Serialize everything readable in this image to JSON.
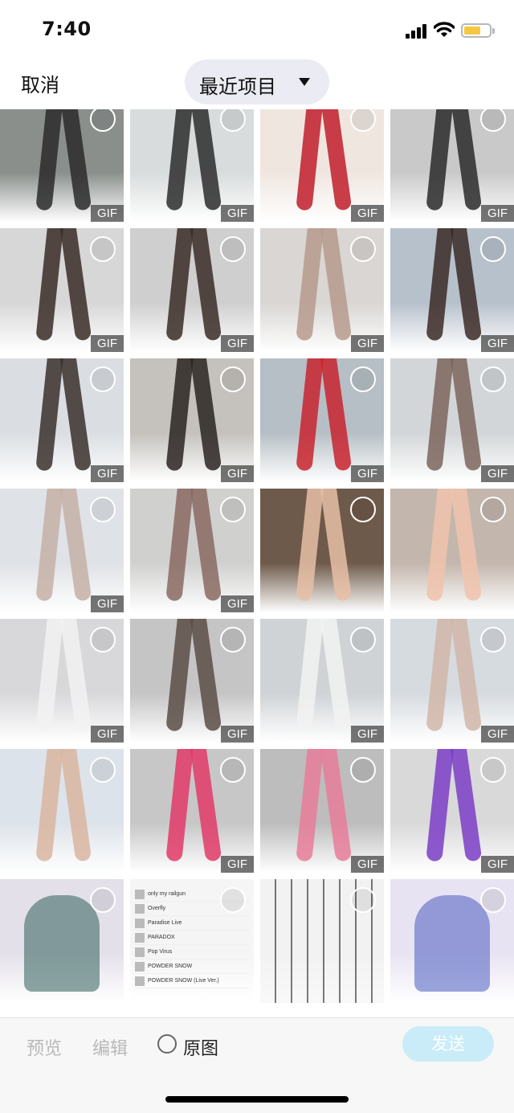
{
  "status_bar": {
    "time": "7:40",
    "battery_color": "#f5c842"
  },
  "header": {
    "cancel_label": "取消",
    "album_label": "最近项目",
    "dropdown_icon": "caret-down-icon"
  },
  "grid": {
    "gif_badge": "GIF",
    "tiles": [
      {
        "gif": true,
        "bg": "#8a8f8c",
        "accent": "#2a2a2a"
      },
      {
        "gif": true,
        "bg": "#d8dcdc",
        "accent": "#2b2b2b"
      },
      {
        "gif": true,
        "bg": "#efe6e0",
        "accent": "#c01d2a"
      },
      {
        "gif": true,
        "bg": "#c9c9c9",
        "accent": "#2a2a2a"
      },
      {
        "gif": true,
        "bg": "#d7d7d7",
        "accent": "#3a2c28"
      },
      {
        "gif": true,
        "bg": "#cfcfcf",
        "accent": "#3a2c28"
      },
      {
        "gif": true,
        "bg": "#d9d6d3",
        "accent": "#b69a8c"
      },
      {
        "gif": true,
        "bg": "#b7c1cc",
        "accent": "#3b2a26"
      },
      {
        "gif": true,
        "bg": "#dadee2",
        "accent": "#3a302c"
      },
      {
        "gif": true,
        "bg": "#c5c2bd",
        "accent": "#2a2422"
      },
      {
        "gif": true,
        "bg": "#b6bfc5",
        "accent": "#c8232e"
      },
      {
        "gif": true,
        "bg": "#d3d6d8",
        "accent": "#7b655d"
      },
      {
        "gif": true,
        "bg": "#dfe2e6",
        "accent": "#c5b0a6"
      },
      {
        "gif": true,
        "bg": "#d0d0cf",
        "accent": "#8a6a62"
      },
      {
        "gif": false,
        "bg": "#6e5a4a",
        "accent": "#e7c0a6"
      },
      {
        "gif": false,
        "bg": "#c3b6ad",
        "accent": "#f0c3ad"
      },
      {
        "gif": true,
        "bg": "#d8d8db",
        "accent": "#f2f2f2"
      },
      {
        "gif": true,
        "bg": "#c5c5c5",
        "accent": "#5a4c47"
      },
      {
        "gif": true,
        "bg": "#cfd3d6",
        "accent": "#f2f2f2"
      },
      {
        "gif": true,
        "bg": "#d6dbe0",
        "accent": "#d1b6a8"
      },
      {
        "gif": false,
        "bg": "#dde3ea",
        "accent": "#d9b5a0"
      },
      {
        "gif": true,
        "bg": "#c7c7c7",
        "accent": "#e03a68"
      },
      {
        "gif": true,
        "bg": "#bdbdbd",
        "accent": "#e77c9a"
      },
      {
        "gif": true,
        "bg": "#d9d9d9",
        "accent": "#7a3dc6"
      },
      {
        "gif": false,
        "bg": "#e4e0ea",
        "accent": "#2f5f5a"
      },
      {
        "gif": false,
        "bg": "#f5f5f5",
        "accent": "#888888"
      },
      {
        "gif": false,
        "bg": "#efefef",
        "accent": "#222222"
      },
      {
        "gif": false,
        "bg": "#e8e3f2",
        "accent": "#4a5cc0"
      }
    ],
    "music_list": [
      "only my railgun",
      "Overfly",
      "Paradise Live",
      "PARADOX",
      "Pop Virus",
      "POWDER SNOW",
      "POWDER SNOW (Live Ver.)"
    ]
  },
  "bottom_bar": {
    "preview_label": "预览",
    "edit_label": "编辑",
    "original_label": "原图",
    "send_label": "发送",
    "send_color": "#c9ecf8"
  }
}
